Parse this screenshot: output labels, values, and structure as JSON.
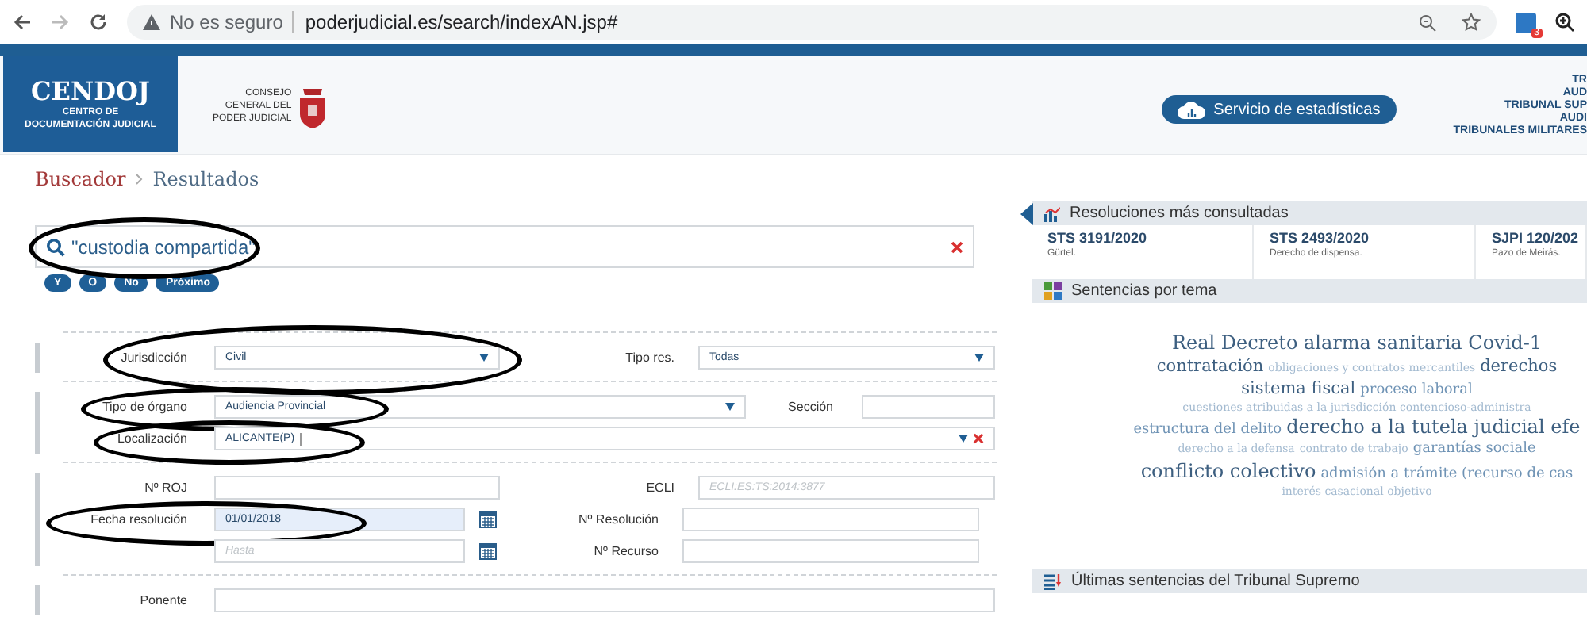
{
  "browser": {
    "security_label": "No es seguro",
    "url": "poderjudicial.es/search/indexAN.jsp#",
    "extension_badge": "3"
  },
  "header": {
    "logo_title": "CENDOJ",
    "logo_subtitle": [
      "CENTRO DE",
      "DOCUMENTACIÓN JUDICIAL"
    ],
    "council": [
      "CONSEJO",
      "GENERAL DEL",
      "PODER JUDICIAL"
    ],
    "stats_button": "Servicio de estadísticas",
    "court_links": [
      "TR",
      "AUD",
      "TRIBUNAL SUP",
      "AUDI",
      "TRIBUNALES MILITARES"
    ]
  },
  "breadcrumb": [
    {
      "label": "Buscador",
      "selected": false
    },
    {
      "label": "Resultados",
      "selected": true
    }
  ],
  "search": {
    "value": "\"custodia compartida\"",
    "circled": true
  },
  "operators": [
    "Y",
    "O",
    "No",
    "Próximo"
  ],
  "filters": [
    {
      "rows": [
        {
          "kind": "pair",
          "label": "Jurisdicción",
          "field": {
            "kind": "select",
            "value": "Civil"
          },
          "label2": "Tipo res.",
          "field2": {
            "kind": "select",
            "value": "Todas"
          },
          "circled": true
        }
      ]
    },
    {
      "rows": [
        {
          "kind": "wide",
          "label": "Tipo de órgano",
          "field": {
            "kind": "select",
            "value": "Audiencia Provincial"
          },
          "label2": "Sección",
          "field2": {
            "kind": "input"
          },
          "circled": true
        },
        {
          "kind": "full",
          "label": "Localización",
          "field": {
            "kind": "multiselect",
            "value": "ALICANTE(P)",
            "focused": true
          },
          "circled": true
        }
      ]
    },
    {
      "rows": [
        {
          "kind": "pair",
          "label": "Nº ROJ",
          "field": {
            "kind": "input"
          },
          "label2": "ECLI",
          "field2": {
            "kind": "input",
            "placeholder": "ECLI:ES:TS:2014:3877"
          }
        },
        {
          "kind": "date",
          "label": "Fecha resolución",
          "field": {
            "kind": "date",
            "value": "01/01/2018",
            "focused": true
          },
          "label2": "Nº Resolución",
          "field2": {
            "kind": "input"
          },
          "circled": true
        },
        {
          "kind": "date",
          "field": {
            "kind": "date",
            "placeholder": "Hasta",
            "focused": false
          },
          "label2": "Nº Recurso",
          "field2": {
            "kind": "input"
          }
        }
      ]
    },
    {
      "rows": [
        {
          "kind": "full",
          "label": "Ponente",
          "field": {
            "kind": "input"
          }
        }
      ]
    }
  ],
  "sidebar": {
    "most_consulted": {
      "title": "Resoluciones más consultadas",
      "items": [
        {
          "ref": "STS 3191/2020",
          "summary": "Gürtel."
        },
        {
          "ref": "STS 2493/2020",
          "summary": "Derecho de dispensa."
        },
        {
          "ref": "SJPI 120/202",
          "summary": "Pazo de Meirás."
        }
      ]
    },
    "by_topic": {
      "title": "Sentencias por tema",
      "lines": [
        [
          {
            "text": "Real Decreto alarma sanitaria Covid-1",
            "kind": "large"
          }
        ],
        [
          {
            "text": "contratación",
            "kind": "strong"
          },
          {
            "text": "obligaciones y contratos mercantiles",
            "kind": "light"
          },
          {
            "text": "derechos",
            "kind": "strong"
          }
        ],
        [
          {
            "text": "sistema fiscal",
            "kind": "strong"
          },
          {
            "text": "proceso laboral",
            "kind": "medium"
          }
        ],
        [
          {
            "text": "cuestiones atribuidas a la jurisdicción contencioso-administra",
            "kind": "light"
          }
        ],
        [
          {
            "text": "estructura del delito",
            "kind": "medium"
          },
          {
            "text": "derecho a la tutela judicial efe",
            "kind": "large"
          }
        ],
        [
          {
            "text": "derecho a la defensa",
            "kind": "light"
          },
          {
            "text": "contrato de trabajo",
            "kind": "light"
          },
          {
            "text": "garantías sociale",
            "kind": "medium"
          }
        ],
        [
          {
            "text": "conflicto colectivo",
            "kind": "large"
          },
          {
            "text": "admisión a trámite (recurso de cas",
            "kind": "medium"
          }
        ],
        [
          {
            "text": "interés casacional objetivo",
            "kind": "light"
          }
        ]
      ]
    },
    "latest": {
      "title": "Últimas sentencias del Tribunal Supremo"
    }
  }
}
